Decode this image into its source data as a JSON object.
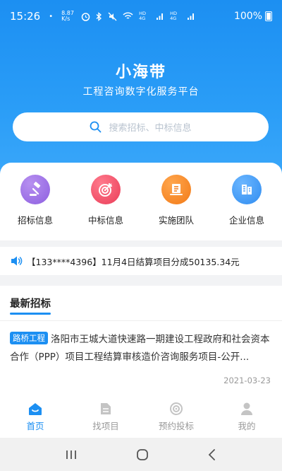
{
  "status_bar": {
    "time": "15:26",
    "dot": "•",
    "speed": "8.87 K/s",
    "network1": "HD 4G",
    "network2": "HD 4G",
    "battery": "100%"
  },
  "header": {
    "title": "小海带",
    "subtitle": "工程咨询数字化服务平台"
  },
  "search": {
    "placeholder": "搜索招标、中标信息"
  },
  "menu": [
    {
      "label": "招标信息",
      "icon": "gavel-icon",
      "color": "#9b6fe6"
    },
    {
      "label": "中标信息",
      "icon": "target-icon",
      "color": "#f0516a"
    },
    {
      "label": "实施团队",
      "icon": "team-book-icon",
      "color": "#f68a26"
    },
    {
      "label": "企业信息",
      "icon": "building-icon",
      "color": "#3e9cf5"
    }
  ],
  "notice": {
    "text": "【133****4396】11月4日结算项目分成50135.34元",
    "icon": "speaker-icon"
  },
  "latest": {
    "section_title": "最新招标",
    "items": [
      {
        "tag": "路桥工程",
        "title": "洛阳市王城大道快速路一期建设工程政府和社会资本合作（PPP）项目工程结算审核造价咨询服务项目-公开...",
        "date": "2021-03-23"
      }
    ]
  },
  "tabbar": [
    {
      "label": "首页",
      "icon": "home-icon",
      "active": true
    },
    {
      "label": "找项目",
      "icon": "document-icon",
      "active": false
    },
    {
      "label": "预约投标",
      "icon": "target-icon",
      "active": false
    },
    {
      "label": "我的",
      "icon": "person-icon",
      "active": false
    }
  ],
  "colors": {
    "primary": "#1c8ff2",
    "background": "#f2f3f5"
  },
  "system_nav": {
    "recent": "recent-apps-icon",
    "home": "home-circle-icon",
    "back": "back-icon"
  }
}
